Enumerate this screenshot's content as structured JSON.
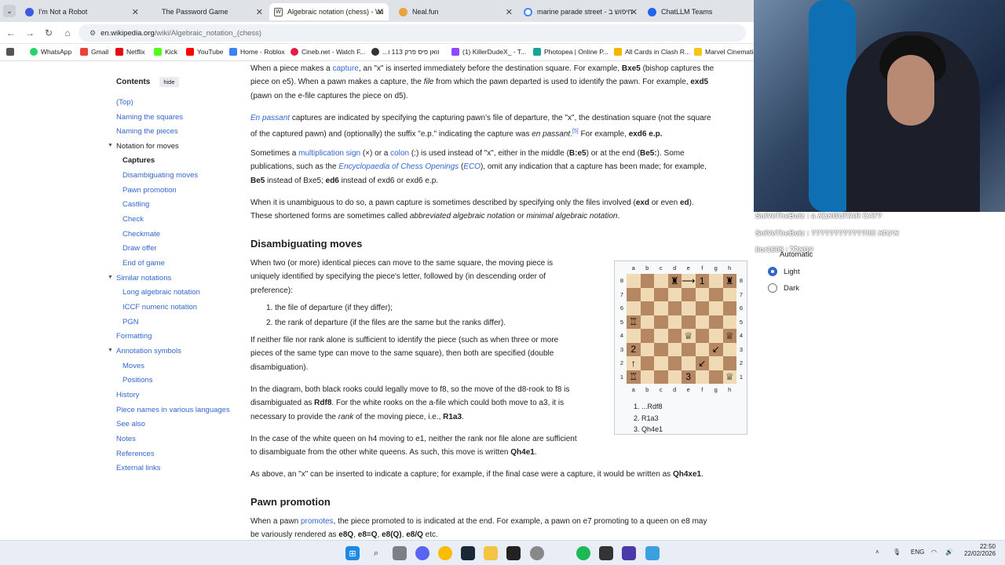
{
  "browser": {
    "tabs": [
      {
        "title": "I'm Not a Robot",
        "active": false
      },
      {
        "title": "The Password Game",
        "active": false
      },
      {
        "title": "Algebraic notation (chess) - Wi",
        "active": true
      },
      {
        "title": "Neal.fun",
        "active": false
      },
      {
        "title": "marine parade street - חיפוש ב",
        "active": false
      },
      {
        "title": "ChatLLM Teams",
        "active": false
      }
    ],
    "url_domain": "en.wikipedia.org",
    "url_path": "/wiki/Algebraic_notation_(chess)",
    "bookmarks": [
      "WhatsApp",
      "Gmail",
      "Netflix",
      "Kick",
      "YouTube",
      "Home - Roblox",
      "Cineb.net - Watch F...",
      "...וואן פיס פרק 113 ו",
      "(1) KillerDudeX_ - T...",
      "Photopea | Online P...",
      "All Cards in Clash R...",
      "Marvel Cinematic"
    ]
  },
  "toc": {
    "title": "Contents",
    "hide": "hide",
    "items": [
      "(Top)",
      "Naming the squares",
      "Naming the pieces",
      "Notation for moves",
      "Captures",
      "Disambiguating moves",
      "Pawn promotion",
      "Castling",
      "Check",
      "Checkmate",
      "Draw offer",
      "End of game",
      "Similar notations",
      "Long algebraic notation",
      "ICCF numeric notation",
      "PGN",
      "Formatting",
      "Annotation symbols",
      "Moves",
      "Positions",
      "History",
      "Piece names in various languages",
      "See also",
      "Notes",
      "References",
      "External links"
    ]
  },
  "article": {
    "p1": [
      "When a piece makes a ",
      "capture",
      ", an \"x\" is inserted immediately before the destination square. For example, ",
      "Bxe5",
      " (bishop captures the",
      "piece on e5). When a pawn makes a capture, the ",
      "file",
      " from which the pawn departed is used to identify the pawn. For example, ",
      "exd5",
      "(pawn on the e-file captures the piece on d5)."
    ],
    "p2": [
      "En passant",
      " captures are indicated by specifying the capturing pawn's file of departure, the \"x\", the destination square (not the square",
      "of the captured pawn) and (optionally) the suffix \"e.p.\" indicating the capture was ",
      "en passant",
      ".",
      "[5]",
      " For example, ",
      "exd6 e.p."
    ],
    "p3": [
      "Sometimes a ",
      "multiplication sign",
      " (×) or a ",
      "colon",
      " (:) is used instead of \"x\", either in the middle (",
      "B:e5",
      ") or at the end (",
      "Be5:",
      "). Some",
      "publications, such as the ",
      "Encyclopaedia of Chess Openings",
      " (",
      "ECO",
      "), omit any indication that a capture has been made; for example,",
      "Be5",
      " instead of Bxe5; ",
      "ed6",
      " instead of exd6 or exd6 e.p."
    ],
    "p4": [
      "When it is unambiguous to do so, a pawn capture is sometimes described by specifying only the files involved (",
      "exd",
      " or even ",
      "ed",
      ").",
      "These shortened forms are sometimes called ",
      "abbreviated algebraic notation",
      " or ",
      "minimal algebraic notation",
      "."
    ],
    "h_disamb": "Disambiguating moves",
    "p5": [
      "When two (or more) identical pieces can move to the same square, the moving piece is",
      "uniquely identified by specifying the piece's letter, followed by (in descending order of",
      "preference):"
    ],
    "list": [
      "1.  the file of departure (if they differ);",
      "2.  the rank of departure (if the files are the same but the ranks differ)."
    ],
    "p6": [
      "If neither file nor rank alone is sufficient to identify the piece (such as when three or more",
      "pieces of the same type can move to the same square), then both are specified (double",
      "disambiguation)."
    ],
    "p7": [
      "In the diagram, both black rooks could legally move to f8, so the move of the d8-rook to f8 is",
      "disambiguated as ",
      "Rdf8",
      ". For the white rooks on the a-file which could both move to a3, it is",
      "necessary to provide the ",
      "rank",
      " of the moving piece, i.e., ",
      "R1a3",
      "."
    ],
    "p8": [
      "In the case of the white queen on h4 moving to e1, neither the rank nor file alone are sufficient",
      "to disambiguate from the other white queens. As such, this move is written ",
      "Qh4e1",
      "."
    ],
    "p9": [
      "As above, an \"x\" can be inserted to indicate a capture; for example, if the final case were a capture, it would be written as ",
      "Qh4xe1",
      "."
    ],
    "h_promo": "Pawn promotion",
    "p10": [
      "When a pawn ",
      "promotes",
      ", the piece promoted to is indicated at the end. For example, a pawn on e7 promoting to a queen on e8 may",
      "be variously rendered as ",
      "e8Q",
      ", ",
      "e8=Q",
      ", ",
      "e8(Q)",
      ", ",
      "e8/Q",
      " etc."
    ]
  },
  "diagram": {
    "files": [
      "a",
      "b",
      "c",
      "d",
      "e",
      "f",
      "g",
      "h"
    ],
    "ranks": [
      "8",
      "7",
      "6",
      "5",
      "4",
      "3",
      "2",
      "1"
    ],
    "pieces": {
      "d8": "♜",
      "e8": "⟶",
      "f8": "1",
      "h8": "♜",
      "a5": "♖",
      "e4": "♕",
      "h4": "♕",
      "a3": "2",
      "g3": "↙",
      "a2": "↑",
      "f2": "↙",
      "a1": "♖",
      "e1": "3",
      "h1": "♕"
    },
    "moves": [
      "1. ...Rdf8",
      "2. R1a3",
      "3. Qh4e1"
    ]
  },
  "stream": {
    "chat": [
      {
        "user": "SniVeTheBoiz",
        "text": ": a אבאGUITAR CAT?"
      },
      {
        "user": "SniVeTheBoiz",
        "text": ": ????????????!!!! אינחא"
      },
      {
        "user": "llor1605",
        "text": ": עטאלל"
      }
    ]
  },
  "appearance": {
    "options": [
      "Automatic",
      "Light",
      "Dark"
    ],
    "selected": "Light"
  },
  "taskbar": {
    "lang": "ENG",
    "time": "22:50",
    "date": "22/02/2026"
  }
}
